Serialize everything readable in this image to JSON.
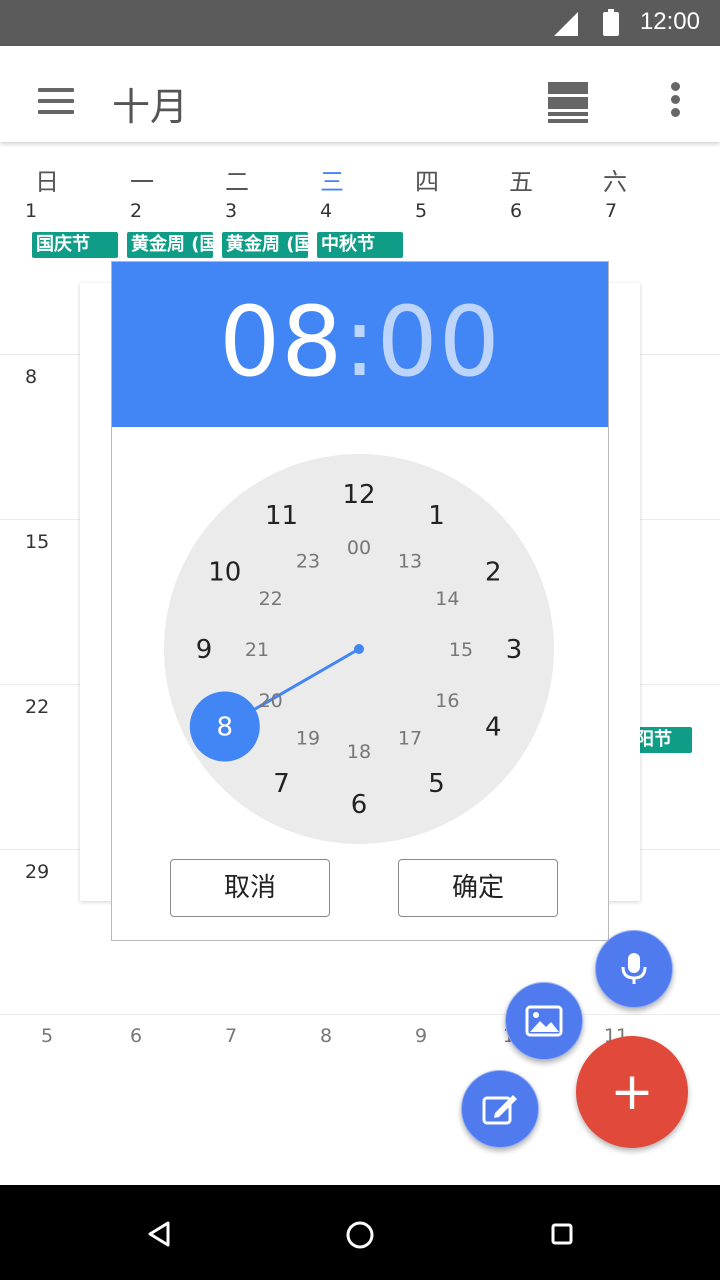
{
  "status_bar": {
    "time": "12:00"
  },
  "toolbar": {
    "title": "十月"
  },
  "calendar": {
    "weekdays": [
      "日",
      "一",
      "二",
      "三",
      "四",
      "五",
      "六"
    ],
    "today_index": 3,
    "first_row_dates": [
      "1",
      "2",
      "3",
      "4",
      "5",
      "6",
      "7"
    ],
    "events": [
      "国庆节",
      "黄金周 (国",
      "黄金周 (国",
      "中秋节"
    ],
    "side_event": "阳节",
    "week_start_dates": [
      "8",
      "15",
      "22",
      "29"
    ],
    "next_month_dates": [
      "5",
      "6",
      "7",
      "8",
      "9",
      "10",
      "11"
    ]
  },
  "time_picker": {
    "hour": "08",
    "separator": ":",
    "minute": "00",
    "selected_hour": 8,
    "outer_numbers": [
      "12",
      "1",
      "2",
      "3",
      "4",
      "5",
      "6",
      "7",
      "8",
      "9",
      "10",
      "11"
    ],
    "inner_numbers": [
      "00",
      "13",
      "14",
      "15",
      "16",
      "17",
      "18",
      "19",
      "20",
      "21",
      "22",
      "23"
    ],
    "cancel_label": "取消",
    "ok_label": "确定"
  },
  "fabs": {
    "add_label": "+",
    "icons": [
      "mic-icon",
      "image-icon",
      "edit-icon",
      "plus-icon"
    ]
  },
  "colors": {
    "accent": "#4285f4",
    "event_chip": "#0f9d87",
    "fab_add": "#e14a3b",
    "fab_small": "#4f7bef",
    "clock_face": "#ebebeb"
  }
}
